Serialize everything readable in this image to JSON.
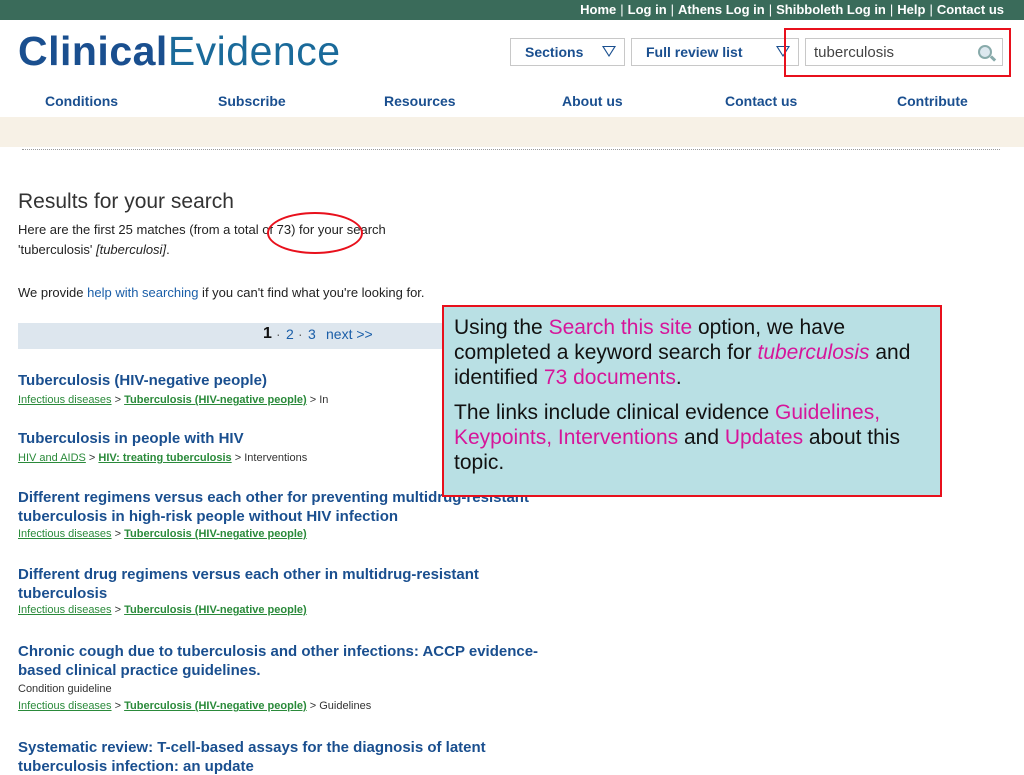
{
  "top_links": [
    "Home",
    "Log in",
    "Athens Log in",
    "Shibboleth Log in",
    "Help",
    "Contact us"
  ],
  "logo": {
    "part1": "Clinical",
    "part2": "Evidence"
  },
  "header": {
    "sections": "Sections",
    "full_review": "Full review list",
    "search_value": "tuberculosis"
  },
  "nav": [
    "Conditions",
    "Subscribe",
    "Resources",
    "About us",
    "Contact us",
    "Contribute"
  ],
  "results": {
    "heading": "Results for your search",
    "line1": "Here are the first 25 matches (from a total of 73) for your search",
    "query": "'tuberculosis'",
    "query_alt": "[tuberculosi]",
    "query_end": ".",
    "help_pre": "We provide ",
    "help_link": "help with searching",
    "help_post": " if you can't find what you're looking for."
  },
  "pagination": {
    "current": "1",
    "p2": "2",
    "p3": "3",
    "next": "next >>"
  },
  "items": [
    {
      "title": "Tuberculosis (HIV-negative people)",
      "crumb1": "Infectious diseases",
      "crumb2": "Tuberculosis (HIV-negative people)",
      "crumb3": "In"
    },
    {
      "title": "Tuberculosis in people with HIV",
      "crumb1": "HIV and AIDS",
      "crumb2": "HIV: treating tuberculosis",
      "crumb3": "Interventions"
    },
    {
      "title_l1": "Different regimens versus each other for preventing multidrug-resistant",
      "title_l2": "tuberculosis in high-risk people without HIV infection",
      "crumb1": "Infectious diseases",
      "crumb2": "Tuberculosis (HIV-negative people)"
    },
    {
      "title_l1": "Different drug regimens versus each other in multidrug-resistant",
      "title_l2": "tuberculosis",
      "crumb1": "Infectious diseases",
      "crumb2": "Tuberculosis (HIV-negative people)"
    },
    {
      "title_l1": "Chronic cough due to tuberculosis and other infections: ACCP evidence-",
      "title_l2": "based clinical practice guidelines.",
      "extra": "Condition guideline",
      "crumb1": "Infectious diseases",
      "crumb2": "Tuberculosis (HIV-negative people)",
      "crumb3": "Guidelines"
    },
    {
      "title_l1": "Systematic review: T-cell-based assays for the diagnosis of latent",
      "title_l2": "tuberculosis infection: an update"
    }
  ],
  "callout": {
    "a1": "Using the ",
    "a2": "Search this site",
    "a3": " option, we have completed a keyword search for ",
    "a4": "tuberculosis",
    "a5": " and identified ",
    "a6": "73 documents",
    "a7": ".",
    "b1": "The links include clinical evidence ",
    "b2": "Guidelines, Keypoints, Interventions",
    "b3": " and ",
    "b4": "Updates",
    "b5": " about this topic."
  },
  "colors": {
    "top_bar": "#3a6b5a",
    "link_blue": "#1a4f8f",
    "crumb_green": "#2a8a3a",
    "annotation_red": "#e8101c",
    "callout_bg": "#b9e0e4",
    "highlight_magenta": "#d6159a"
  }
}
